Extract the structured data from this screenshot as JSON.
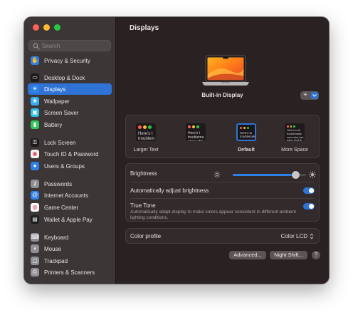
{
  "sidebar": {
    "search_placeholder": "Search",
    "items": [
      {
        "label": "Privacy & Security",
        "icon": "hand-icon",
        "color": "#2f7fe8"
      },
      {
        "label": "Desktop & Dock",
        "icon": "dock-icon",
        "color": "#1c1c1e"
      },
      {
        "label": "Displays",
        "icon": "sun-icon",
        "color": "#2f7fe8",
        "active": true
      },
      {
        "label": "Wallpaper",
        "icon": "flower-icon",
        "color": "#35aef0"
      },
      {
        "label": "Screen Saver",
        "icon": "screen-saver-icon",
        "color": "#2dc0e0"
      },
      {
        "label": "Battery",
        "icon": "battery-icon",
        "color": "#34c759"
      },
      {
        "label": "Lock Screen",
        "icon": "lock-icon",
        "color": "#1c1c1e"
      },
      {
        "label": "Touch ID & Password",
        "icon": "fingerprint-icon",
        "color": "#f7f2f2"
      },
      {
        "label": "Users & Groups",
        "icon": "users-icon",
        "color": "#2f7fe8"
      },
      {
        "label": "Passwords",
        "icon": "key-icon",
        "color": "#8e8e93"
      },
      {
        "label": "Internet Accounts",
        "icon": "at-icon",
        "color": "#2f7fe8"
      },
      {
        "label": "Game Center",
        "icon": "game-center-icon",
        "color": "#ffffff"
      },
      {
        "label": "Wallet & Apple Pay",
        "icon": "wallet-icon",
        "color": "#1c1c1e"
      },
      {
        "label": "Keyboard",
        "icon": "keyboard-icon",
        "color": "#8e8e93"
      },
      {
        "label": "Mouse",
        "icon": "mouse-icon",
        "color": "#8e8e93"
      },
      {
        "label": "Trackpad",
        "icon": "trackpad-icon",
        "color": "#8e8e93"
      },
      {
        "label": "Printers & Scanners",
        "icon": "printer-icon",
        "color": "#8e8e93"
      }
    ]
  },
  "main": {
    "title": "Displays",
    "display_name": "Built-in Display",
    "add_button_label": "+",
    "resolutions": [
      {
        "label": "Larger Text",
        "preview": [
          "Here's t",
          "troublem"
        ]
      },
      {
        "label": "",
        "preview": [
          "Here's t",
          "troublema",
          "ones who"
        ]
      },
      {
        "label": "Default",
        "selected": true,
        "preview": [
          "Here's to",
          "troublemakers",
          "ones who see"
        ]
      },
      {
        "label": "More Space",
        "preview": [
          "Here's to th",
          "troublemake",
          "ones who see",
          "rules. And th"
        ]
      }
    ],
    "brightness_label": "Brightness",
    "brightness_level": 0.86,
    "auto_brightness_label": "Automatically adjust brightness",
    "auto_brightness_on": true,
    "true_tone_label": "True Tone",
    "true_tone_description": "Automatically adapt display to make colors appear consistent in different ambient lighting conditions.",
    "true_tone_on": true,
    "color_profile_label": "Color profile",
    "color_profile_value": "Color LCD",
    "advanced_button": "Advanced...",
    "night_shift_button": "Night Shift...",
    "help_button": "?"
  },
  "colors": {
    "accent": "#2f73d7",
    "window_bg": "#2a2122",
    "sidebar_bg": "#3d3637"
  }
}
